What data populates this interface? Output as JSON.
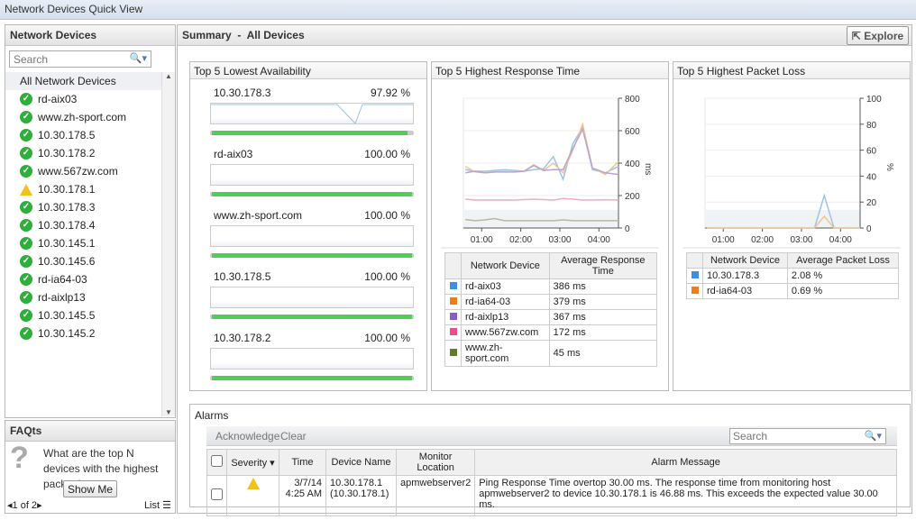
{
  "window_title": "Network Devices Quick View",
  "sidebar": {
    "title": "Network Devices",
    "search_placeholder": "Search",
    "all_label": "All Network Devices",
    "devices": [
      {
        "name": "rd-aix03",
        "status": "ok"
      },
      {
        "name": "www.zh-sport.com",
        "status": "ok"
      },
      {
        "name": "10.30.178.5",
        "status": "ok"
      },
      {
        "name": "10.30.178.2",
        "status": "ok"
      },
      {
        "name": "www.567zw.com",
        "status": "ok"
      },
      {
        "name": "10.30.178.1",
        "status": "warning"
      },
      {
        "name": "10.30.178.3",
        "status": "ok"
      },
      {
        "name": "10.30.178.4",
        "status": "ok"
      },
      {
        "name": "10.30.145.1",
        "status": "ok"
      },
      {
        "name": "10.30.145.6",
        "status": "ok"
      },
      {
        "name": "rd-ia64-03",
        "status": "ok"
      },
      {
        "name": "rd-aixlp13",
        "status": "ok"
      },
      {
        "name": "10.30.145.5",
        "status": "ok"
      },
      {
        "name": "10.30.145.2",
        "status": "ok"
      }
    ]
  },
  "faq": {
    "title": "FAQts",
    "question": "What are the top N devices with the highest packet loss",
    "button": "Show Me",
    "pager": "1 of 2",
    "list_label": "List"
  },
  "main": {
    "title": "Summary  -  All Devices",
    "explore": "Explore"
  },
  "availability": {
    "title": "Top 5 Lowest Availability",
    "items": [
      {
        "name": "10.30.178.3",
        "value": "97.92 %",
        "percent": 97.92
      },
      {
        "name": "rd-aix03",
        "value": "100.00 %",
        "percent": 100
      },
      {
        "name": "www.zh-sport.com",
        "value": "100.00 %",
        "percent": 100
      },
      {
        "name": "10.30.178.5",
        "value": "100.00 %",
        "percent": 100
      },
      {
        "name": "10.30.178.2",
        "value": "100.00 %",
        "percent": 100
      }
    ]
  },
  "response": {
    "title": "Top 5 Highest Response Time",
    "col_device": "Network Device",
    "col_value": "Average Response Time",
    "rows": [
      {
        "name": "rd-aix03",
        "value": "386 ms",
        "color": "#3f8fe0"
      },
      {
        "name": "rd-ia64-03",
        "value": "379 ms",
        "color": "#f07d1a"
      },
      {
        "name": "rd-aixlp13",
        "value": "367 ms",
        "color": "#8a5cc2"
      },
      {
        "name": "www.567zw.com",
        "value": "172 ms",
        "color": "#ee4d8a"
      },
      {
        "name": "www.zh-sport.com",
        "value": "45 ms",
        "color": "#667a2e"
      }
    ]
  },
  "packet": {
    "title": "Top 5 Highest Packet Loss",
    "col_device": "Network Device",
    "col_value": "Average Packet Loss",
    "rows": [
      {
        "name": "10.30.178.3",
        "value": "2.08 %",
        "color": "#3f8fe0"
      },
      {
        "name": "rd-ia64-03",
        "value": "0.69 %",
        "color": "#f07d1a"
      }
    ]
  },
  "chart_data": [
    {
      "type": "line",
      "title": "Top 5 Highest Response Time",
      "ylabel": "ms",
      "ylim": [
        0,
        800
      ],
      "yticks": [
        "0",
        "200",
        "400",
        "600",
        "800"
      ],
      "xticks": [
        "01:00",
        "02:00",
        "03:00",
        "04:00"
      ],
      "x": [
        35,
        50,
        65,
        80,
        95,
        110,
        125,
        140,
        155,
        170,
        185,
        200,
        215,
        230,
        250,
        270
      ],
      "series": [
        {
          "name": "rd-aix03",
          "color": "#9cc3ec",
          "values": [
            360,
            350,
            350,
            355,
            360,
            355,
            350,
            360,
            365,
            440,
            300,
            520,
            620,
            360,
            340,
            380
          ]
        },
        {
          "name": "rd-ia64-03",
          "color": "#f4c48f",
          "values": [
            380,
            345,
            340,
            345,
            350,
            345,
            350,
            390,
            355,
            400,
            340,
            480,
            640,
            370,
            330,
            410
          ]
        },
        {
          "name": "rd-aixlp13",
          "color": "#b7a6cf",
          "values": [
            340,
            350,
            340,
            345,
            345,
            345,
            350,
            385,
            355,
            360,
            360,
            490,
            610,
            370,
            340,
            330
          ]
        },
        {
          "name": "www.567zw.com",
          "color": "#f3a9c4",
          "values": [
            178,
            172,
            172,
            172,
            172,
            172,
            175,
            178,
            175,
            172,
            182,
            178,
            172,
            172,
            174,
            172
          ]
        },
        {
          "name": "www.zh-sport.com",
          "color": "#b5b89f",
          "values": [
            52,
            45,
            50,
            58,
            45,
            45,
            45,
            45,
            45,
            45,
            50,
            45,
            45,
            45,
            45,
            45
          ]
        }
      ]
    },
    {
      "type": "line",
      "title": "Top 5 Highest Packet Loss",
      "ylabel": "%",
      "ylim": [
        0,
        100
      ],
      "yticks": [
        "0",
        "20",
        "40",
        "60",
        "80",
        "100"
      ],
      "xticks": [
        "01:00",
        "02:00",
        "03:00",
        "04:00"
      ],
      "x": [
        35,
        200,
        215,
        230,
        250,
        270
      ],
      "series": [
        {
          "name": "10.30.178.3",
          "color": "#9cc3ec",
          "values": [
            0,
            0,
            25,
            0,
            0,
            0
          ]
        },
        {
          "name": "rd-ia64-03",
          "color": "#f4c48f",
          "values": [
            0,
            0,
            9,
            0,
            0,
            0
          ]
        }
      ]
    }
  ],
  "alarms": {
    "title": "Alarms",
    "acknowledge": "Acknowledge",
    "clear": "Clear",
    "search_placeholder": "Search",
    "columns": [
      "Severity",
      "Time",
      "Device Name",
      "Monitor Location",
      "Alarm Message"
    ],
    "rows": [
      {
        "severity": "warning",
        "time": "3/7/14 4:25 AM",
        "device": "10.30.178.1 (10.30.178.1)",
        "location": "apmwebserver2",
        "message": "Ping Response Time overtop 30.00 ms. The response time from monitoring host apmwebserver2 to device 10.30.178.1 is 46.88 ms. This exceeds the expected value 30.00 ms."
      }
    ]
  }
}
